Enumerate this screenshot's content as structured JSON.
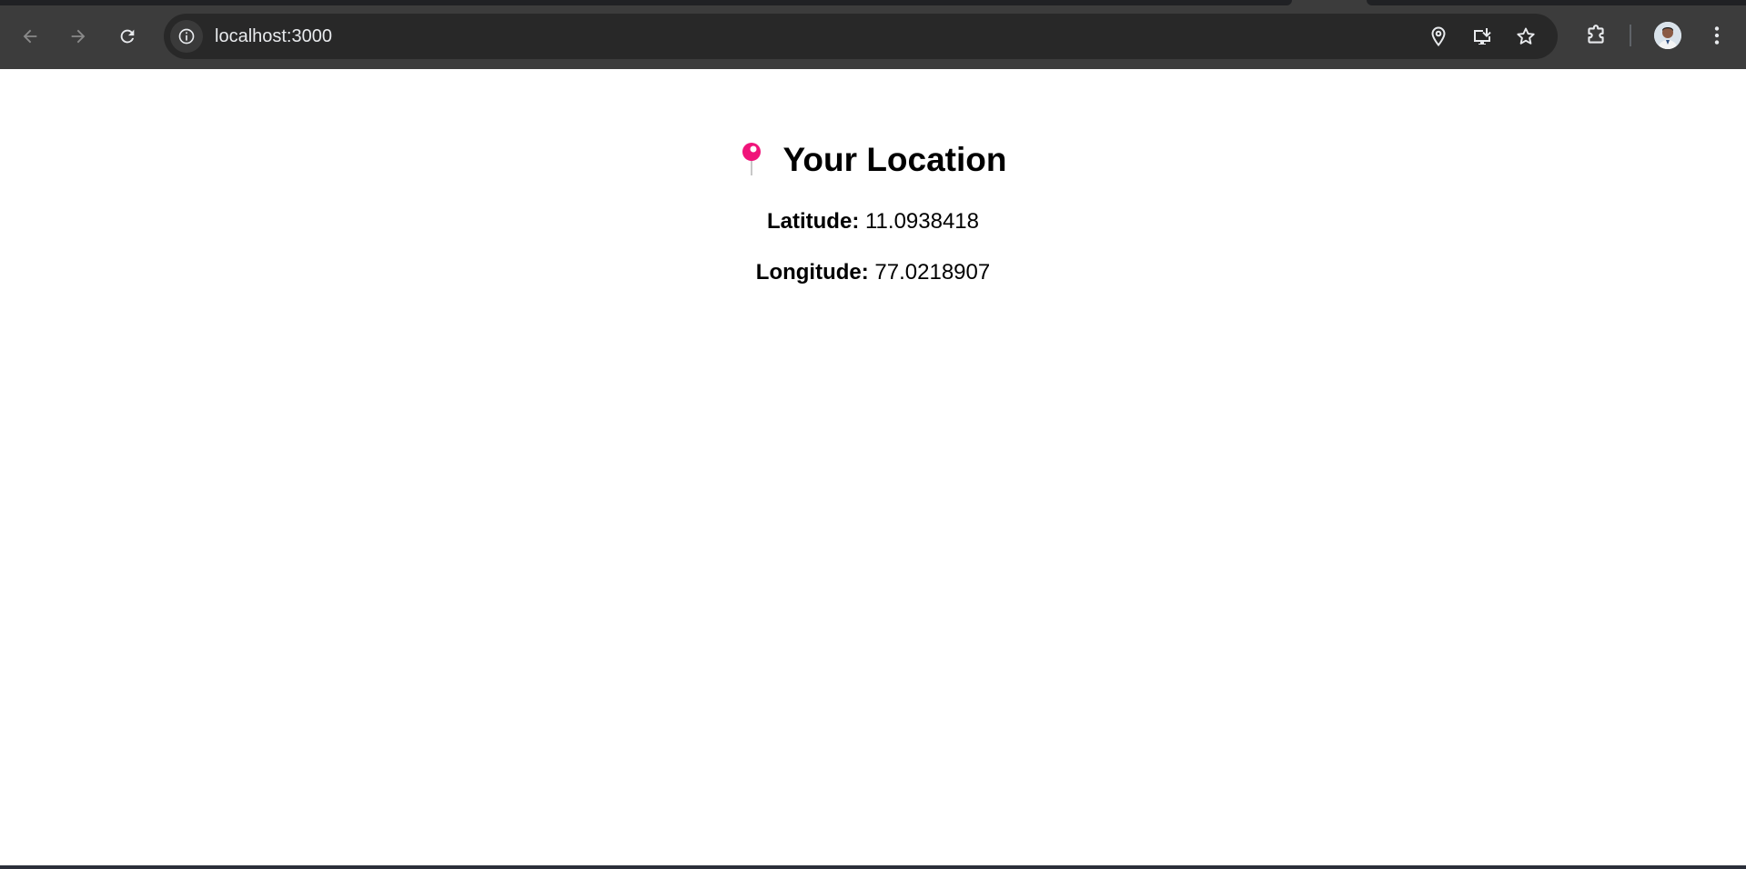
{
  "browser": {
    "url": "localhost:3000",
    "icons": {
      "back": "arrow-left-icon",
      "forward": "arrow-right-icon",
      "reload": "reload-icon",
      "site_info": "info-icon",
      "location": "location-pin-icon",
      "install": "install-app-icon",
      "bookmark": "star-icon",
      "extensions": "puzzle-icon",
      "profile": "avatar",
      "menu": "kebab-menu-icon"
    },
    "colors": {
      "toolbar": "#3c3c3c",
      "omnibox": "#282828",
      "icon": "#e8eaed"
    }
  },
  "page": {
    "heading": {
      "icon": "round-pushpin-icon",
      "icon_color": "#f0147a",
      "text": "Your Location"
    },
    "latitude": {
      "label": "Latitude:",
      "value": "11.0938418"
    },
    "longitude": {
      "label": "Longitude:",
      "value": "77.0218907"
    }
  }
}
